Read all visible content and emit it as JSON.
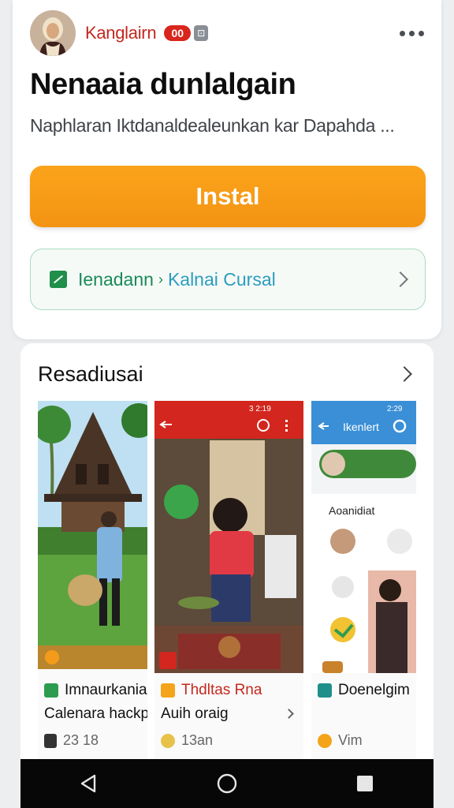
{
  "developer": {
    "name": "Kanglairn",
    "badge": "00",
    "badge2": "⊡"
  },
  "app": {
    "title": "Nenaaia dunlalgain",
    "description": "Naphlaran Iktdanaldealeunkan kar Dapahda ..."
  },
  "install": {
    "label": "Instal"
  },
  "collection": {
    "label": "Ienadann",
    "sub": "Kalnai Cursal"
  },
  "screenshots": {
    "title": "Resadiusai",
    "items": [
      {
        "caption1": "Imnaurkania",
        "caption2": "Calenara hackpt",
        "meta": "23 18"
      },
      {
        "caption1": "Thdltas Rna",
        "caption2": "Auih oraig",
        "meta": "13an",
        "status_time": "3 2:19",
        "bubble": ""
      },
      {
        "caption1": "Doenelgim",
        "caption2": "",
        "meta": "Vim",
        "status_time": "2:29",
        "topbar": "Ikenlert",
        "section": "Aoanidiat"
      }
    ]
  },
  "colors": {
    "accent": "#f39412",
    "brand_red": "#c4281f",
    "green": "#1a8a58"
  },
  "icons": [
    "more-vert-icon",
    "chevron-right-icon",
    "back-icon",
    "home-icon",
    "recents-icon"
  ]
}
